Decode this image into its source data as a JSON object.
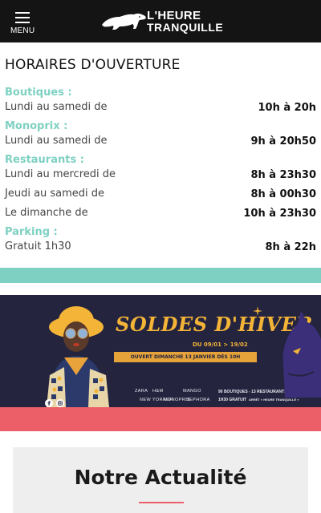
{
  "header": {
    "menu_label": "MENU",
    "logo_line1": "L'HEURE",
    "logo_line2": "TRANQUILLE"
  },
  "hours": {
    "title": "HORAIRES D'OUVERTURE",
    "boutiques": {
      "label": "Boutiques :",
      "rows": [
        {
          "day": "Lundi au samedi de",
          "time": "10h à 20h"
        }
      ]
    },
    "monoprix": {
      "label": "Monoprix :",
      "rows": [
        {
          "day": "Lundi au samedi de",
          "time": "9h à 20h50"
        }
      ]
    },
    "restaurants": {
      "label": "Restaurants :",
      "rows": [
        {
          "day": "Lundi au mercredi de",
          "time": "8h à 23h30"
        },
        {
          "day": "Jeudi au samedi de",
          "time": "8h à 00h30"
        },
        {
          "day": "Le dimanche de",
          "time": "10h à 23h30"
        }
      ]
    },
    "parking": {
      "label": "Parking :",
      "rows": [
        {
          "day": "Gratuit 1h30",
          "time": "8h à 22h"
        }
      ]
    }
  },
  "banner": {
    "title": "SOLDES D'HIVER",
    "dates": "DU 09/01 > 19/02",
    "open_notice": "OUVERT DIMANCHE 13 JANVIER DÈS 10H",
    "brands": [
      "ZARA",
      "H&M",
      "MANGO",
      "NEW YORKER",
      "MONOPRIX",
      "SEPHORA"
    ],
    "stats": {
      "shops": "90 BOUTIQUES - 13 RESTAURANTS",
      "parking": "1H30 GRATUIT",
      "tram": "ARRÊT « HEURE TRANQUILLE »"
    }
  },
  "news": {
    "title": "Notre Actualité"
  },
  "colors": {
    "header_bg": "#141414",
    "accent_teal": "#7ed1c2",
    "accent_coral": "#ec5e68",
    "banner_bg": "#24243f",
    "banner_gold": "#f3b437"
  }
}
